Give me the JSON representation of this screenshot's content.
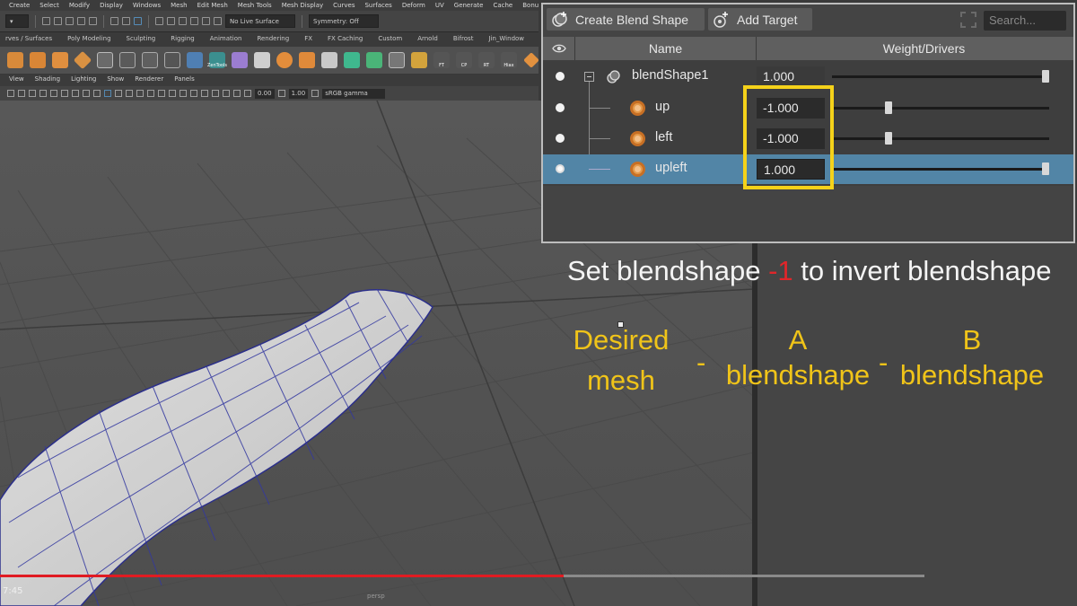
{
  "maya": {
    "menus": [
      "Create",
      "Select",
      "Modify",
      "Display",
      "Windows",
      "Mesh",
      "Edit Mesh",
      "Mesh Tools",
      "Mesh Display",
      "Curves",
      "Surfaces",
      "Deform",
      "UV",
      "Generate",
      "Cache",
      "Bonus Tools"
    ],
    "live_surface": "No Live Surface",
    "symmetry": "Symmetry: Off",
    "shelf_tabs": [
      "rves / Surfaces",
      "Poly Modeling",
      "Sculpting",
      "Rigging",
      "Animation",
      "Rendering",
      "FX",
      "FX Caching",
      "Custom",
      "Arnold",
      "Bifrost",
      "Jin_Window",
      "Jin_W"
    ],
    "shelf_labels": [
      "ZenTools",
      "FT",
      "CP",
      "RT",
      "Hiax"
    ],
    "panel_menus": [
      "View",
      "Shading",
      "Lighting",
      "Show",
      "Renderer",
      "Panels"
    ],
    "panel_fields": [
      "0.00",
      "1.00",
      "sRGB gamma"
    ],
    "camera": "persp"
  },
  "blend_editor": {
    "create_button": "Create Blend Shape",
    "add_target_button": "Add Target",
    "search_placeholder": "Search...",
    "col_name": "Name",
    "col_weight": "Weight/Drivers",
    "rows": [
      {
        "name": "blendShape1",
        "value": "1.000",
        "weight": 1.0
      },
      {
        "name": "up",
        "value": "-1.000",
        "weight": -1.0
      },
      {
        "name": "left",
        "value": "-1.000",
        "weight": -1.0
      },
      {
        "name": "upleft",
        "value": "1.000",
        "weight": 1.0
      }
    ],
    "highlight_color": "#f5d21a",
    "selection_color": "#5285a6"
  },
  "overlay": {
    "title_before": "Set blendshape ",
    "title_neg": "-1",
    "title_after": " to invert blendshape",
    "desired_1": "Desired",
    "desired_2": "mesh",
    "minus1": "-",
    "a_1": "A",
    "a_2": "blendshape",
    "minus2": "-",
    "b_1": "B",
    "b_2": "blendshape",
    "text_color": "#f0c419",
    "neg_color": "#e0262a"
  },
  "video": {
    "timestamp": "7:45",
    "progress": 0.61
  }
}
